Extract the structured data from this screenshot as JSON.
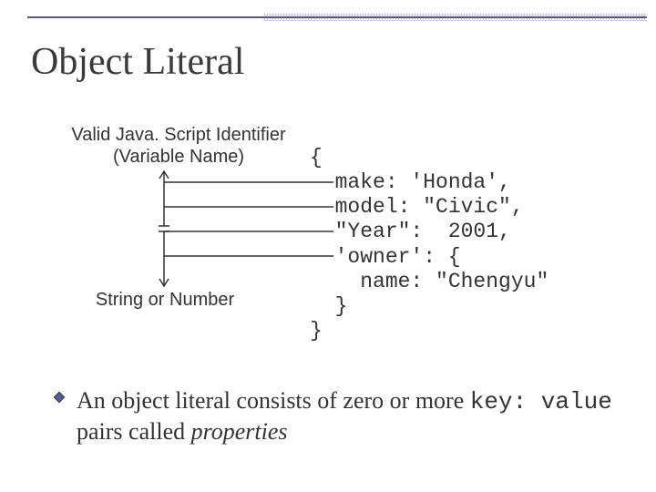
{
  "title": "Object Literal",
  "labels": {
    "identifier_line1": "Valid Java. Script Identifier",
    "identifier_line2": "(Variable Name)",
    "string_or_number": "String or Number"
  },
  "code": {
    "l1": "{",
    "l2": "  make: 'Honda',",
    "l3": "  model: \"Civic\",",
    "l4": "  \"Year\":  2001,",
    "l5": "  'owner': {",
    "l6": "    name: \"Chengyu\"",
    "l7": "  }",
    "l8": "}"
  },
  "bullet": {
    "pre": "An object literal consists of zero or more ",
    "kv": "key: value",
    "mid": " pairs called ",
    "prop": "properties"
  }
}
